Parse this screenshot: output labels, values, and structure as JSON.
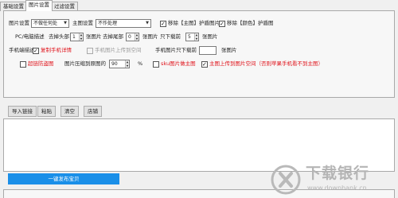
{
  "tabs": [
    {
      "label": "基础设置",
      "active": false
    },
    {
      "label": "图片设置",
      "active": true
    },
    {
      "label": "过滤设置",
      "active": false
    }
  ],
  "row1": {
    "img_label": "图片设置",
    "img_select": "不做任何处",
    "main_label": "主图设置",
    "main_select": "不作处理",
    "cb1": {
      "label": "移除【主图】护盾图片",
      "checked": true
    },
    "cb2": {
      "label": "移除【颜色】护盾图",
      "checked": true
    }
  },
  "row2": {
    "label": "PC/电脑描述",
    "remove_head_label": "去掉头部",
    "remove_head_value": "1",
    "unit1": "张图片",
    "remove_tail_label": "去掉尾部",
    "remove_tail_value": "0",
    "unit2": "张图片",
    "keep_label": "只下载前",
    "keep_value": "5",
    "unit3": "张图片"
  },
  "row3": {
    "label": "手机端描述",
    "cb1": {
      "label": "复制手机详情",
      "checked": true
    },
    "cb2": {
      "label": "手机图片上传到空间",
      "checked": false
    },
    "keep_label": "手机图片只下载前",
    "keep_value": "",
    "unit": "张图片"
  },
  "row4": {
    "cb1": {
      "label": "超链防盗图",
      "checked": false
    },
    "compress_label": "图片压缩到原图的",
    "compress_value": "90",
    "percent": "%",
    "cb2": {
      "label": "sku图片做主图",
      "checked": false
    },
    "cb3": {
      "label": "主图上传到图片空间（否则苹果手机看不到主图）",
      "checked": true
    }
  },
  "buttons": {
    "import": "导入链接",
    "paste": "粘贴",
    "clear": "清空",
    "shop": "店铺"
  },
  "primary_button": "一键发布宝贝",
  "watermark": {
    "text": "下载银行",
    "url": "www.downbank.cn"
  },
  "colors": {
    "accent": "#1a8fe8",
    "red_text": "#e0141c"
  }
}
